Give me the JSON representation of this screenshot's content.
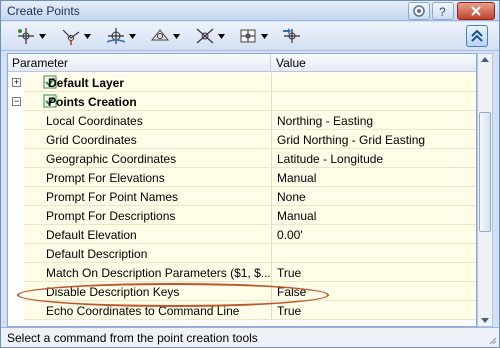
{
  "window": {
    "title": "Create Points"
  },
  "toolbar": {
    "tools": [
      "point-creation-icon",
      "interpolate-icon",
      "alignment-icon",
      "surface-icon",
      "intersection-icon",
      "polyline-icon",
      "convert-icon"
    ],
    "expand_icon": "expand-chevron-icon"
  },
  "grid": {
    "header": {
      "parameter": "Parameter",
      "value": "Value"
    },
    "groups": [
      {
        "label": "Default Layer",
        "expanded": false,
        "expander": "⊞"
      },
      {
        "label": "Points Creation",
        "expanded": true,
        "expander": "⊟"
      }
    ],
    "rows": [
      {
        "label": "Local Coordinates",
        "value": "Northing - Easting"
      },
      {
        "label": "Grid Coordinates",
        "value": "Grid Northing - Grid Easting"
      },
      {
        "label": "Geographic Coordinates",
        "value": "Latitude - Longitude"
      },
      {
        "label": "Prompt For Elevations",
        "value": "Manual"
      },
      {
        "label": "Prompt For Point Names",
        "value": "None"
      },
      {
        "label": "Prompt For Descriptions",
        "value": "Manual"
      },
      {
        "label": "Default Elevation",
        "value": "0.00'"
      },
      {
        "label": "Default Description",
        "value": ""
      },
      {
        "label": "Match On Description Parameters ($1, $...",
        "value": "True"
      },
      {
        "label": "Disable Description Keys",
        "value": "False"
      },
      {
        "label": "Echo Coordinates to Command Line",
        "value": "True"
      }
    ]
  },
  "status": {
    "text": "Select a command from the point creation tools"
  },
  "colors": {
    "highlight_oval": "#c0542a",
    "row_bg": "#fffde8",
    "window_bg": "#d4e1f3"
  }
}
